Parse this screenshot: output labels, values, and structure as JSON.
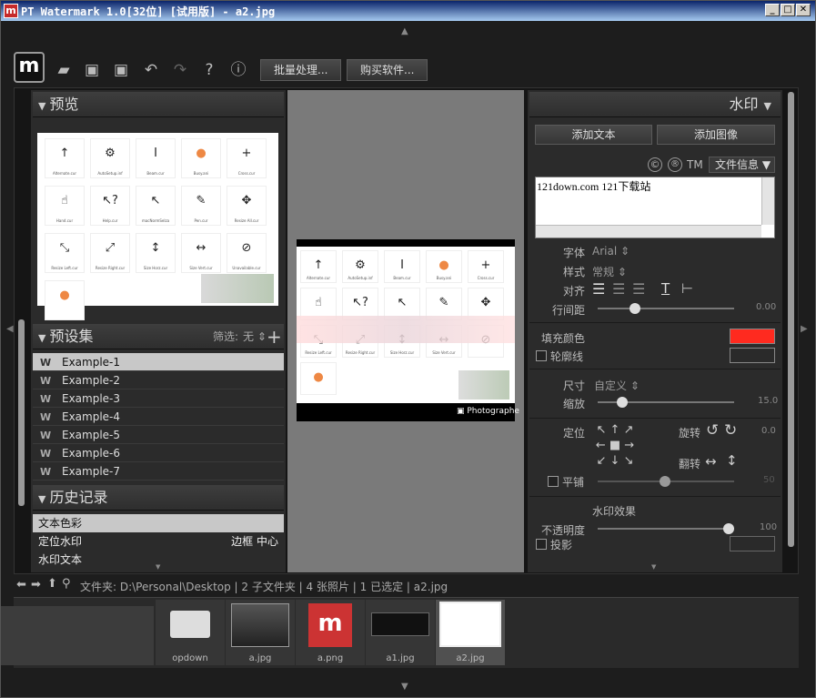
{
  "window": {
    "title": "PT Watermark 1.0[32位] [试用版] - a2.jpg",
    "icon_letter": "m"
  },
  "toolbar": {
    "batch_label": "批量处理...",
    "buy_label": "购买软件...",
    "icons": [
      "open-folder-icon",
      "save-icon",
      "save-as-icon",
      "undo-icon",
      "redo-icon",
      "help-icon",
      "info-icon"
    ]
  },
  "preview_panel": {
    "title": "预览",
    "cells": [
      {
        "glyph": "↑",
        "name": "Alternate.cur"
      },
      {
        "glyph": "⚙",
        "name": "AutoSetup.inf"
      },
      {
        "glyph": "I",
        "name": "Beam.cur"
      },
      {
        "glyph": "●",
        "name": "Busy.ani"
      },
      {
        "glyph": "+",
        "name": "Cross.cur"
      },
      {
        "glyph": "☝",
        "name": "Hand.cur"
      },
      {
        "glyph": "↖?",
        "name": "Help.cur"
      },
      {
        "glyph": "↖",
        "name": "macNormSelza"
      },
      {
        "glyph": "✎",
        "name": "Pen.cur"
      },
      {
        "glyph": "✥",
        "name": "Resize All.cur"
      },
      {
        "glyph": "⤡",
        "name": "Resize Left.cur"
      },
      {
        "glyph": "⤢",
        "name": "Resize Right.cur"
      },
      {
        "glyph": "↕",
        "name": "Size Horz.cur"
      },
      {
        "glyph": "↔",
        "name": "Size Vert.cur"
      },
      {
        "glyph": "⊘",
        "name": "Unavailable.cur"
      },
      {
        "glyph": "●",
        "name": ""
      }
    ]
  },
  "presets_panel": {
    "title": "预设集",
    "filter_label": "筛选:",
    "filter_value": "无",
    "items": [
      "Example-1",
      "Example-2",
      "Example-3",
      "Example-4",
      "Example-5",
      "Example-6",
      "Example-7"
    ]
  },
  "history_panel": {
    "title": "历史记录",
    "items": [
      {
        "label": "文本色彩",
        "detail": ""
      },
      {
        "label": "定位水印",
        "detail": "边框 中心"
      },
      {
        "label": "水印文本",
        "detail": ""
      }
    ]
  },
  "canvas": {
    "photographer_label": "Photographe",
    "cells": [
      {
        "glyph": "↑",
        "name": "Alternate.cur"
      },
      {
        "glyph": "⚙",
        "name": "AutoSetup.inf"
      },
      {
        "glyph": "I",
        "name": "Beam.cur"
      },
      {
        "glyph": "●",
        "name": "Busy.ani"
      },
      {
        "glyph": "+",
        "name": "Cross.cur"
      },
      {
        "glyph": "☝",
        "name": ""
      },
      {
        "glyph": "↖?",
        "name": ""
      },
      {
        "glyph": "↖",
        "name": ""
      },
      {
        "glyph": "✎",
        "name": ""
      },
      {
        "glyph": "✥",
        "name": ""
      },
      {
        "glyph": "⤡",
        "name": "Resize Left.cur"
      },
      {
        "glyph": "⤢",
        "name": "Resize Right.cur"
      },
      {
        "glyph": "↕",
        "name": "Size Horz.cur"
      },
      {
        "glyph": "↔",
        "name": "Size Vert.cur"
      },
      {
        "glyph": "⊘",
        "name": ""
      },
      {
        "glyph": "●",
        "name": ""
      }
    ]
  },
  "watermark_panel": {
    "title": "水印",
    "add_text_label": "添加文本",
    "add_image_label": "添加图像",
    "copyright_symbol": "©",
    "registered_symbol": "®",
    "trademark_symbol": "TM",
    "file_info_label": "文件信息",
    "text_content": "121down.com 121下载站",
    "font_label": "字体",
    "font_value": "Arial",
    "style_label": "样式",
    "style_value": "常规",
    "align_label": "对齐",
    "line_spacing_label": "行间距",
    "line_spacing_value": "0.00",
    "line_spacing_level": 0.25,
    "fill_color_label": "填充颜色",
    "fill_color": "#ff2a1f",
    "outline_label": "轮廓线",
    "outline_color": "#2a2a2a",
    "size_label": "尺寸",
    "size_value": "自定义",
    "scale_label": "缩放",
    "scale_value": "15.0",
    "scale_level": 0.15,
    "position_label": "定位",
    "rotate_label": "旋转",
    "rotate_value": "0.0",
    "flip_label": "翻转",
    "tile_label": "平铺",
    "tile_value": "50",
    "effects_label": "水印效果",
    "opacity_label": "不透明度",
    "opacity_value": "100",
    "opacity_level": 1.0,
    "shadow_label": "投影"
  },
  "navbar": {
    "path_text": "文件夹:  D:\\Personal\\Desktop | 2 子文件夹 | 4 张照片 | 1 已选定 | a2.jpg"
  },
  "filmstrip": {
    "items": [
      {
        "name": "opdown",
        "kind": "folder"
      },
      {
        "name": "a.jpg",
        "kind": "dark"
      },
      {
        "name": "a.png",
        "kind": "logo"
      },
      {
        "name": "a1.jpg",
        "kind": "dark2"
      },
      {
        "name": "a2.jpg",
        "kind": "light"
      }
    ]
  },
  "colors": {
    "accent_red": "#ff2a1f",
    "panel_bg": "#2b2b2b",
    "canvas_bg": "#7a7a7a"
  }
}
